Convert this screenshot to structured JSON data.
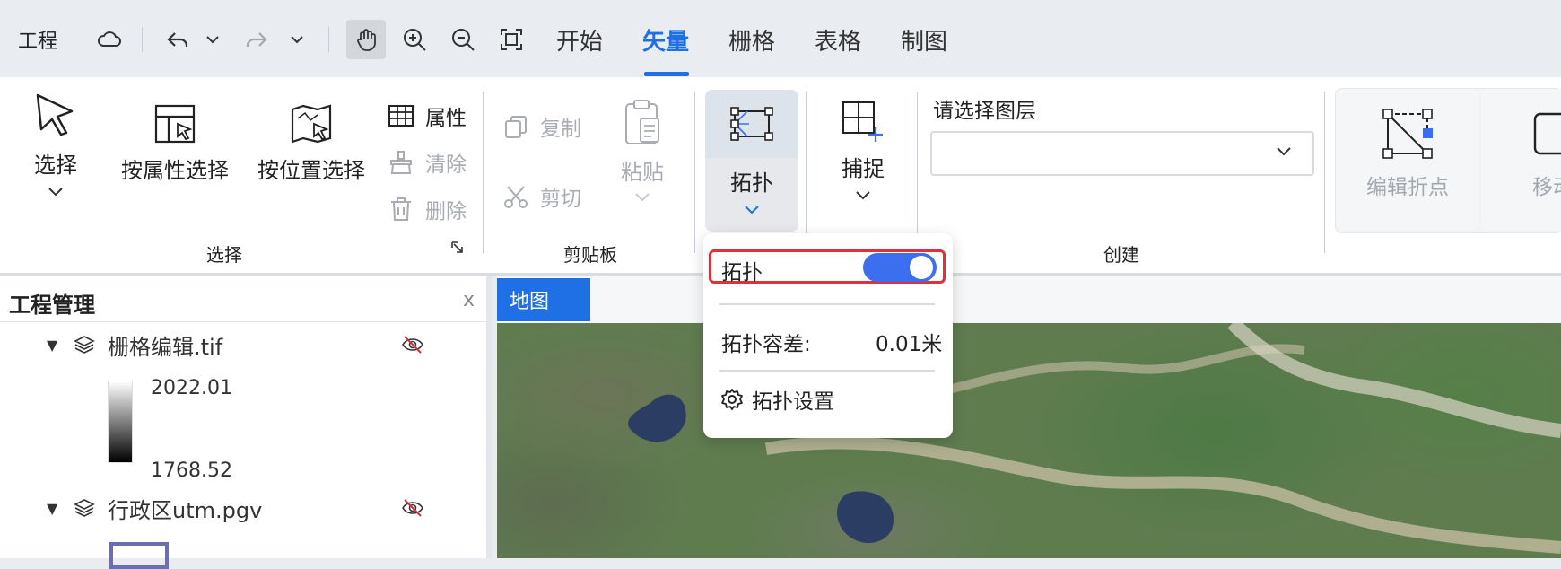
{
  "toolbar": {
    "project_label": "工程",
    "tabs": [
      {
        "label": "开始",
        "active": false
      },
      {
        "label": "矢量",
        "active": true
      },
      {
        "label": "栅格",
        "active": false
      },
      {
        "label": "表格",
        "active": false
      },
      {
        "label": "制图",
        "active": false
      }
    ],
    "accent_color": "#1f6fe5"
  },
  "ribbon": {
    "select_group": {
      "select_label": "选择",
      "by_attr_label": "按属性选择",
      "by_location_label": "按位置选择",
      "attributes_label": "属性",
      "clear_label": "清除",
      "delete_label": "删除",
      "group_label": "选择"
    },
    "clipboard_group": {
      "copy_label": "复制",
      "cut_label": "剪切",
      "paste_label": "粘贴",
      "group_label": "剪贴板"
    },
    "topology_label": "拓扑",
    "snap_label": "捕捉",
    "create_group": {
      "layer_prompt": "请选择图层",
      "layer_value": "",
      "group_label": "创建"
    },
    "edit_vertices_label": "编辑折点",
    "move_label": "移动"
  },
  "project_panel": {
    "title": "工程管理",
    "close_label": "x",
    "layers": [
      {
        "name": "栅格编辑.tif",
        "legend_max": "2022.01",
        "legend_min": "1768.52"
      },
      {
        "name": "行政区utm.pgv"
      }
    ]
  },
  "map": {
    "tab_label": "地图"
  },
  "topology_popup": {
    "topology_label": "拓扑",
    "topology_enabled": true,
    "tolerance_label": "拓扑容差:",
    "tolerance_value": "0.01米",
    "settings_label": "拓扑设置",
    "toggle_color": "#3b6ff0"
  }
}
